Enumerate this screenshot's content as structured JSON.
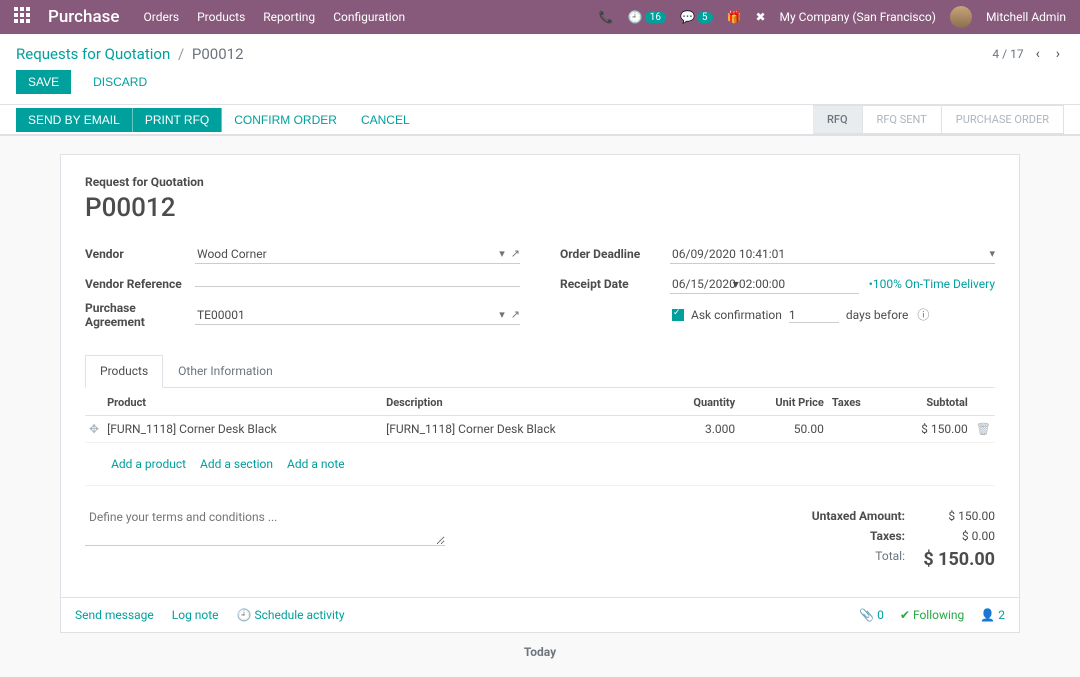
{
  "nav": {
    "brand": "Purchase",
    "menu": [
      "Orders",
      "Products",
      "Reporting",
      "Configuration"
    ],
    "activity_count": "16",
    "msg_count": "5",
    "company": "My Company (San Francisco)",
    "user": "Mitchell Admin"
  },
  "breadcrumb": {
    "parent": "Requests for Quotation",
    "current": "P00012"
  },
  "pager": {
    "text": "4 / 17"
  },
  "actions": {
    "save": "SAVE",
    "discard": "DISCARD"
  },
  "workflow": {
    "send_email": "SEND BY EMAIL",
    "print_rfq": "PRINT RFQ",
    "confirm": "CONFIRM ORDER",
    "cancel": "CANCEL"
  },
  "status": {
    "rfq": "RFQ",
    "rfq_sent": "RFQ SENT",
    "po": "PURCHASE ORDER"
  },
  "form": {
    "title_label": "Request for Quotation",
    "title": "P00012",
    "labels": {
      "vendor": "Vendor",
      "vendor_ref": "Vendor Reference",
      "agreement": "Purchase Agreement",
      "deadline": "Order Deadline",
      "receipt": "Receipt Date",
      "ask_confirm": "Ask confirmation",
      "days_before": "days before"
    },
    "values": {
      "vendor": "Wood Corner",
      "vendor_ref": "",
      "agreement": "TE00001",
      "deadline": "06/09/2020 10:41:01",
      "receipt": "06/15/2020 02:00:00",
      "ontime": "•100% On-Time Delivery",
      "confirm_days": "1"
    }
  },
  "tabs": {
    "products": "Products",
    "other": "Other Information"
  },
  "table": {
    "headers": {
      "product": "Product",
      "description": "Description",
      "qty": "Quantity",
      "unit_price": "Unit Price",
      "taxes": "Taxes",
      "subtotal": "Subtotal"
    },
    "rows": [
      {
        "product": "[FURN_1118] Corner Desk Black",
        "description": "[FURN_1118] Corner Desk Black",
        "qty": "3.000",
        "unit_price": "50.00",
        "taxes": "",
        "subtotal": "$ 150.00"
      }
    ],
    "add_product": "Add a product",
    "add_section": "Add a section",
    "add_note": "Add a note"
  },
  "terms_placeholder": "Define your terms and conditions ...",
  "totals": {
    "untaxed_label": "Untaxed Amount:",
    "untaxed": "$ 150.00",
    "taxes_label": "Taxes:",
    "taxes": "$ 0.00",
    "total_label": "Total:",
    "total": "$ 150.00"
  },
  "chatter": {
    "send": "Send message",
    "log": "Log note",
    "schedule": "Schedule activity",
    "attach_count": "0",
    "following": "Following",
    "followers": "2",
    "today": "Today"
  }
}
